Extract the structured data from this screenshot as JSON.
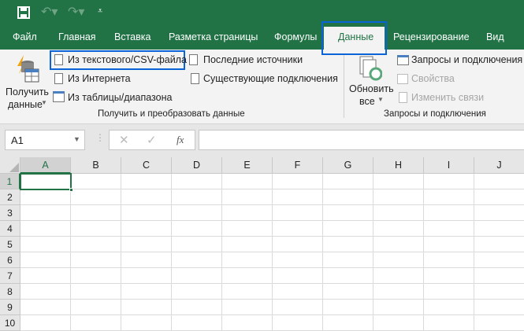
{
  "titlebar": {
    "icons": [
      "save-icon",
      "undo-icon",
      "redo-icon",
      "customize-qat-icon"
    ]
  },
  "tabs": [
    "Файл",
    "Главная",
    "Вставка",
    "Разметка страницы",
    "Формулы",
    "Данные",
    "Рецензирование",
    "Вид"
  ],
  "active_tab": "Данные",
  "ribbon": {
    "get_data": {
      "label1": "Получить",
      "label2": "данные"
    },
    "from_csv": "Из текстового/CSV-файла",
    "from_web": "Из Интернета",
    "from_table": "Из таблицы/диапазона",
    "recent_sources": "Последние источники",
    "existing_connections": "Существующие подключения",
    "group1": "Получить и преобразовать данные",
    "refresh_all": {
      "label1": "Обновить",
      "label2": "все"
    },
    "queries_connections": "Запросы и подключения",
    "properties": "Свойства",
    "edit_links": "Изменить связи",
    "group2": "Запросы и подключения"
  },
  "formula_bar": {
    "name_box": "A1",
    "fx": "fx",
    "formula": ""
  },
  "grid": {
    "columns": [
      "A",
      "B",
      "C",
      "D",
      "E",
      "F",
      "G",
      "H",
      "I",
      "J"
    ],
    "rows": [
      "1",
      "2",
      "3",
      "4",
      "5",
      "6",
      "7",
      "8",
      "9",
      "10"
    ],
    "selected": "A1"
  },
  "colors": {
    "accent": "#217346",
    "highlight": "#0a64d8"
  }
}
